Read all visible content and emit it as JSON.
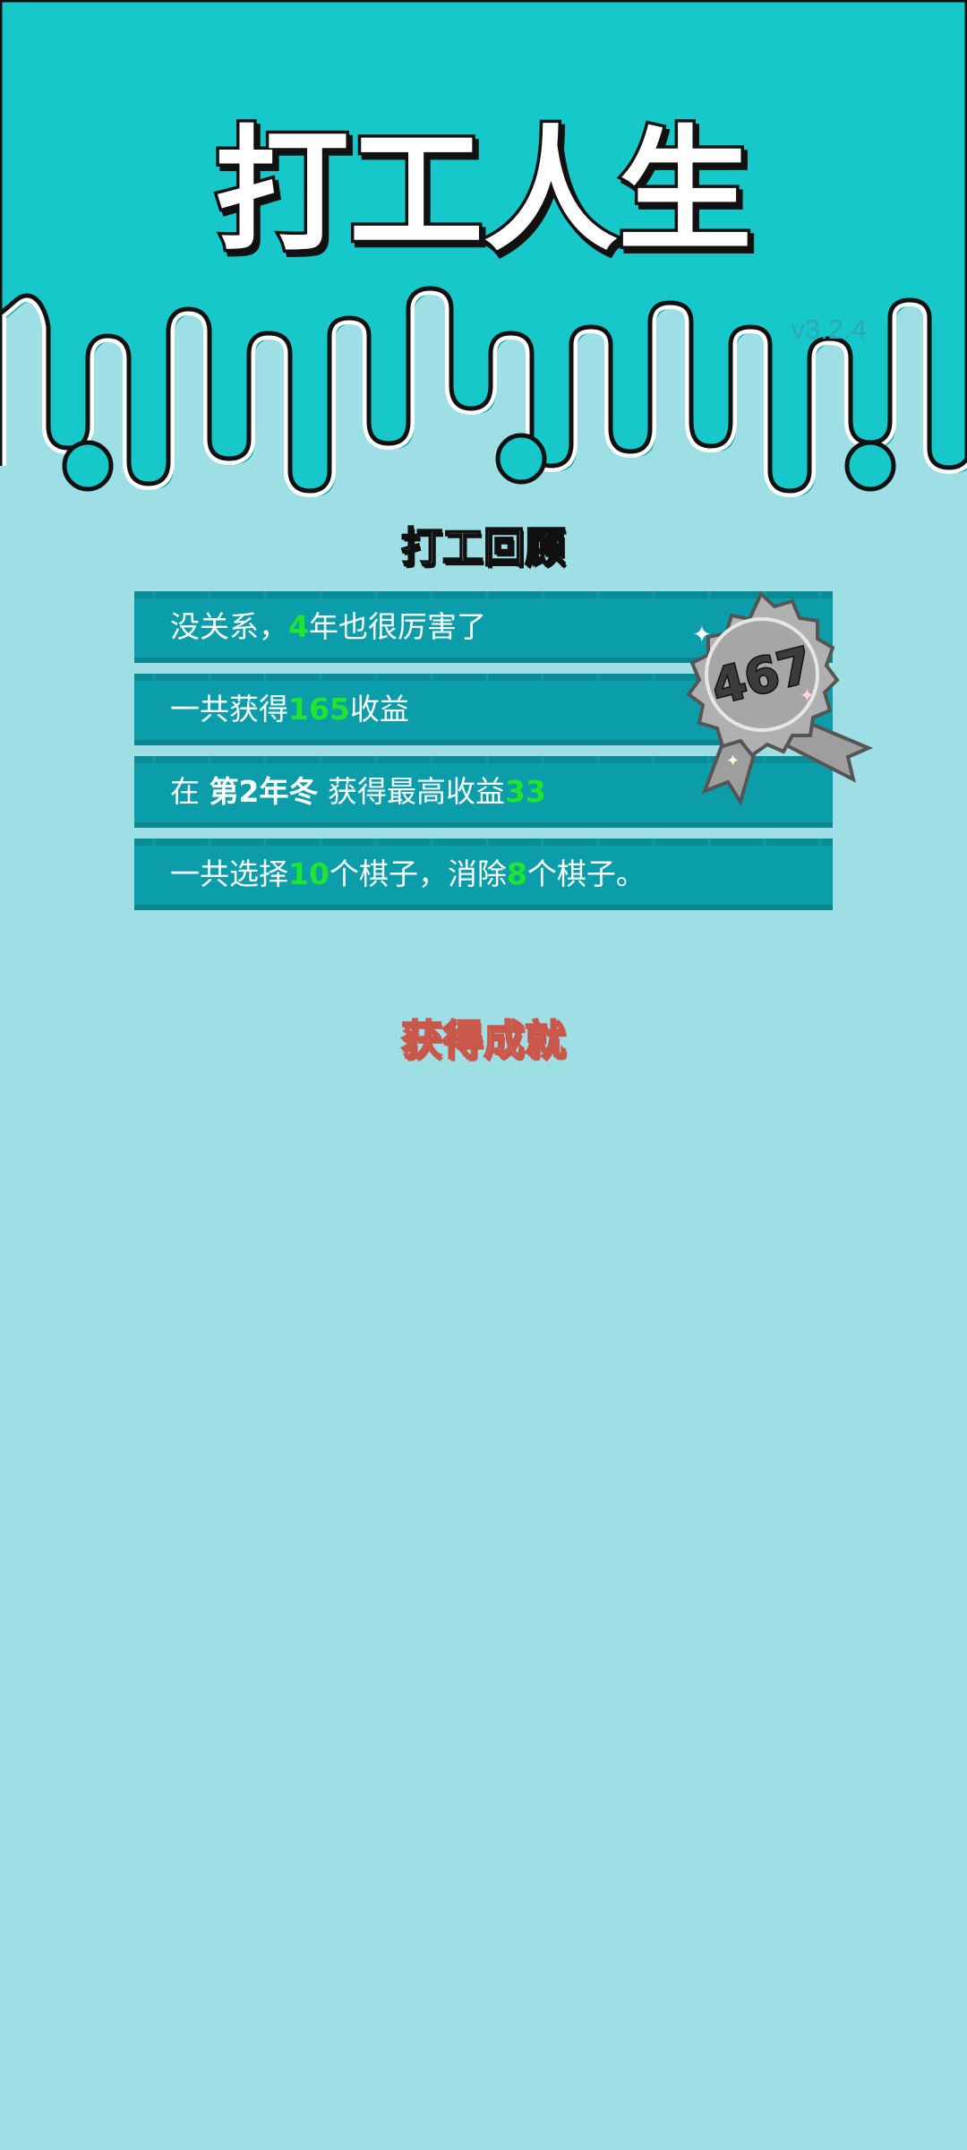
{
  "app": {
    "title": "打工人生",
    "version": "v3.2.4"
  },
  "review": {
    "heading": "打工回顾",
    "rows": [
      {
        "pre": "没关系，",
        "num": "4",
        "post": "年也很厉害了"
      },
      {
        "pre": "一共获得",
        "num": "165",
        "post": "收益"
      },
      {
        "pre": "在 ",
        "bold": "第2年冬",
        "mid": " 获得最高收益",
        "num": "33"
      },
      {
        "pre": "一共选择",
        "num": "10",
        "mid": "个棋子，消除",
        "num2": "8",
        "post": "个棋子。"
      }
    ],
    "badge": {
      "value": "467"
    }
  },
  "achievements": {
    "heading": "获得成就"
  },
  "colors": {
    "background": "#9edfe5",
    "header": "#16c8c9",
    "row": "#0b9eaa",
    "highlight": "#1ee52e",
    "medal": "#b0b0b0"
  }
}
